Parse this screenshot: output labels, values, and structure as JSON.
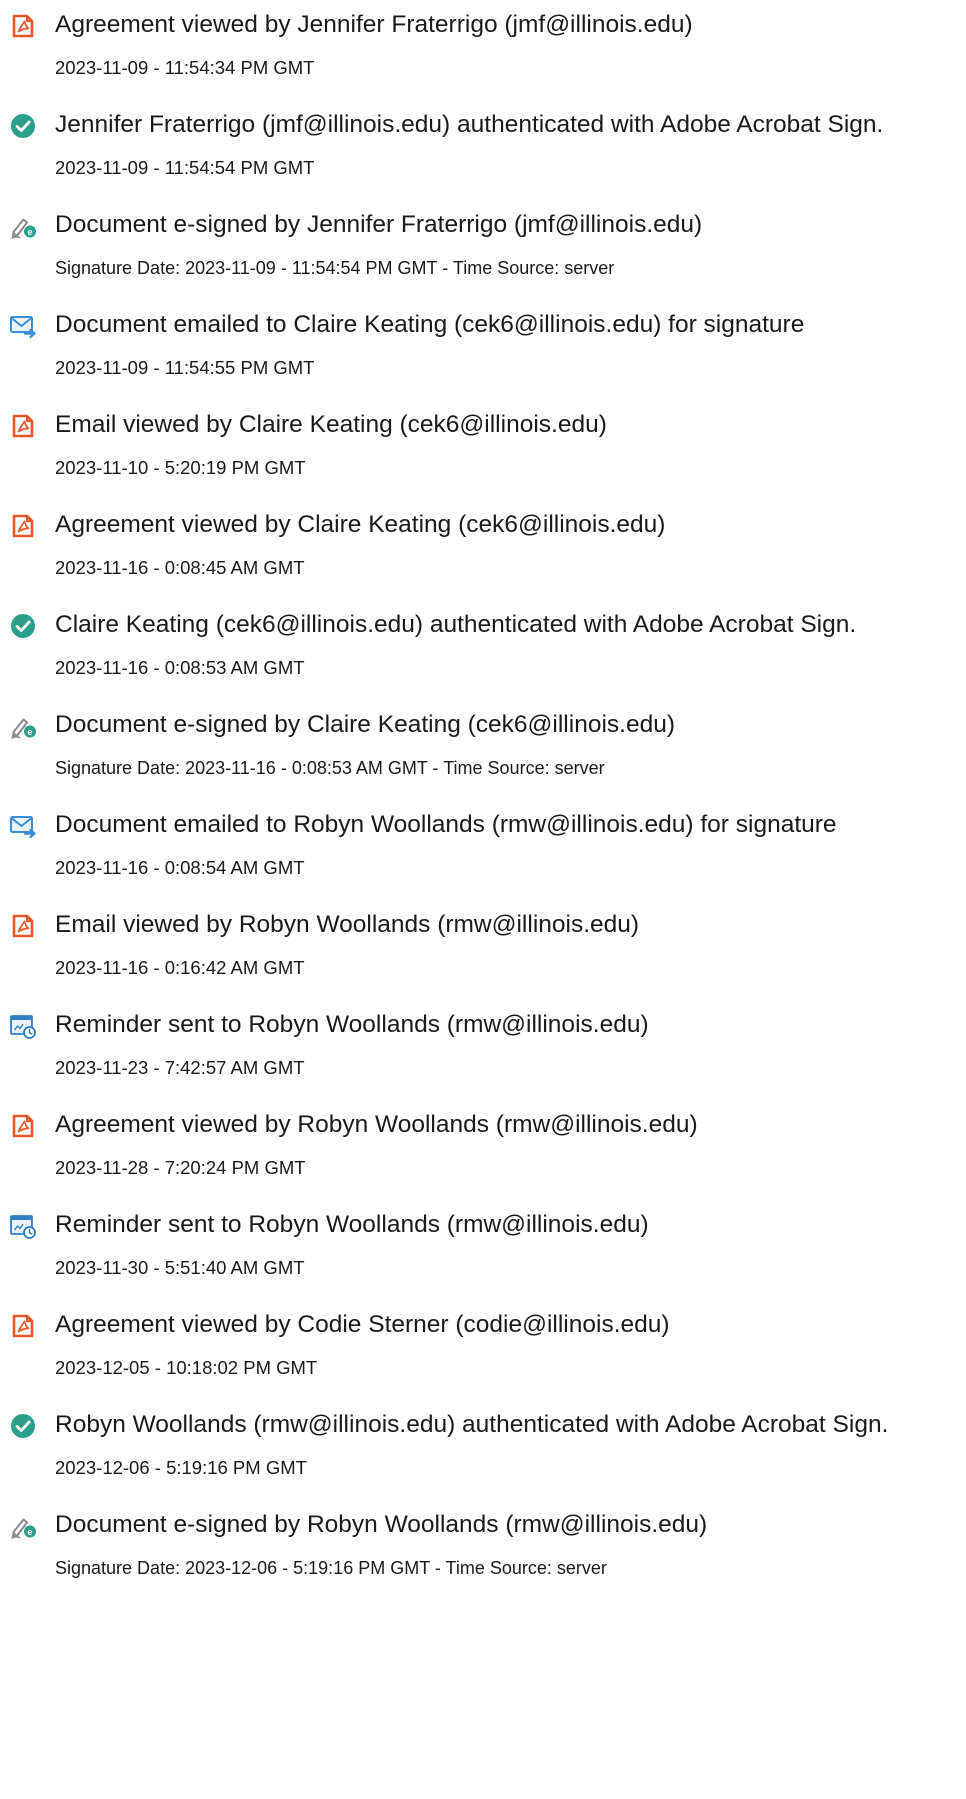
{
  "events": [
    {
      "icon": "agreement-viewed-icon",
      "title": "Agreement viewed by Jennifer Fraterrigo (jmf@illinois.edu)",
      "meta": "2023-11-09 - 11:54:34 PM GMT"
    },
    {
      "icon": "authenticated-check-icon",
      "title": "Jennifer Fraterrigo (jmf@illinois.edu) authenticated with Adobe Acrobat Sign.",
      "meta": "2023-11-09 - 11:54:54 PM GMT"
    },
    {
      "icon": "e-signed-pen-icon",
      "title": "Document e-signed by Jennifer Fraterrigo (jmf@illinois.edu)",
      "meta": "Signature Date: 2023-11-09 - 11:54:54 PM GMT - Time Source: server"
    },
    {
      "icon": "emailed-envelope-icon",
      "title": "Document emailed to Claire Keating (cek6@illinois.edu) for signature",
      "meta": "2023-11-09 - 11:54:55 PM GMT"
    },
    {
      "icon": "agreement-viewed-icon",
      "title": "Email viewed by Claire Keating (cek6@illinois.edu)",
      "meta": "2023-11-10 - 5:20:19 PM GMT"
    },
    {
      "icon": "agreement-viewed-icon",
      "title": "Agreement viewed by Claire Keating (cek6@illinois.edu)",
      "meta": "2023-11-16 - 0:08:45 AM GMT"
    },
    {
      "icon": "authenticated-check-icon",
      "title": "Claire Keating (cek6@illinois.edu) authenticated with Adobe Acrobat Sign.",
      "meta": "2023-11-16 - 0:08:53 AM GMT"
    },
    {
      "icon": "e-signed-pen-icon",
      "title": "Document e-signed by Claire Keating (cek6@illinois.edu)",
      "meta": "Signature Date: 2023-11-16 - 0:08:53 AM GMT - Time Source: server"
    },
    {
      "icon": "emailed-envelope-icon",
      "title": "Document emailed to Robyn Woollands (rmw@illinois.edu) for signature",
      "meta": "2023-11-16 - 0:08:54 AM GMT"
    },
    {
      "icon": "agreement-viewed-icon",
      "title": "Email viewed by Robyn Woollands (rmw@illinois.edu)",
      "meta": "2023-11-16 - 0:16:42 AM GMT"
    },
    {
      "icon": "reminder-calendar-icon",
      "title": "Reminder sent to Robyn Woollands (rmw@illinois.edu)",
      "meta": "2023-11-23 - 7:42:57 AM GMT"
    },
    {
      "icon": "agreement-viewed-icon",
      "title": "Agreement viewed by Robyn Woollands (rmw@illinois.edu)",
      "meta": "2023-11-28 - 7:20:24 PM GMT"
    },
    {
      "icon": "reminder-calendar-icon",
      "title": "Reminder sent to Robyn Woollands (rmw@illinois.edu)",
      "meta": "2023-11-30 - 5:51:40 AM GMT"
    },
    {
      "icon": "agreement-viewed-icon",
      "title": "Agreement viewed by Codie Sterner (codie@illinois.edu)",
      "meta": "2023-12-05 - 10:18:02 PM GMT"
    },
    {
      "icon": "authenticated-check-icon",
      "title": "Robyn Woollands (rmw@illinois.edu) authenticated with Adobe Acrobat Sign.",
      "meta": "2023-12-06 - 5:19:16 PM GMT"
    },
    {
      "icon": "e-signed-pen-icon",
      "title": "Document e-signed by Robyn Woollands (rmw@illinois.edu)",
      "meta": "Signature Date: 2023-12-06 - 5:19:16 PM GMT - Time Source: server"
    }
  ],
  "colors": {
    "viewed": "#e8572a",
    "authenticated": "#2aa08a",
    "signed": "#2aa08a",
    "emailed": "#3a8fd8",
    "reminder": "#2f7fc4"
  }
}
